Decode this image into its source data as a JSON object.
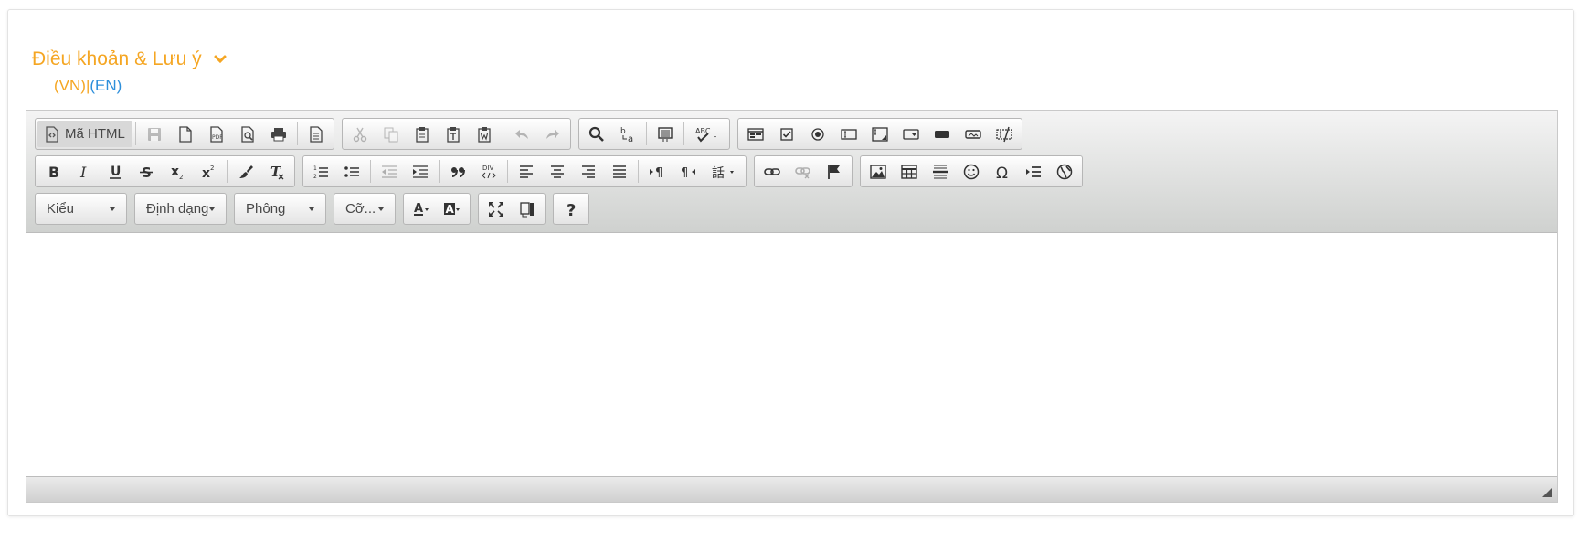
{
  "section": {
    "title": "Điều khoản & Lưu ý",
    "lang_vn": "(VN)",
    "lang_sep": "|",
    "lang_en": "(EN)"
  },
  "toolbar": {
    "source_label": "Mã HTML",
    "style_label": "Kiểu",
    "format_label": "Định dạng",
    "font_label": "Phông",
    "size_label": "Cỡ..."
  },
  "colors": {
    "accent_orange": "#f5a623",
    "link_blue": "#2d8fdb",
    "toolbar_border": "#b6b6b6"
  }
}
